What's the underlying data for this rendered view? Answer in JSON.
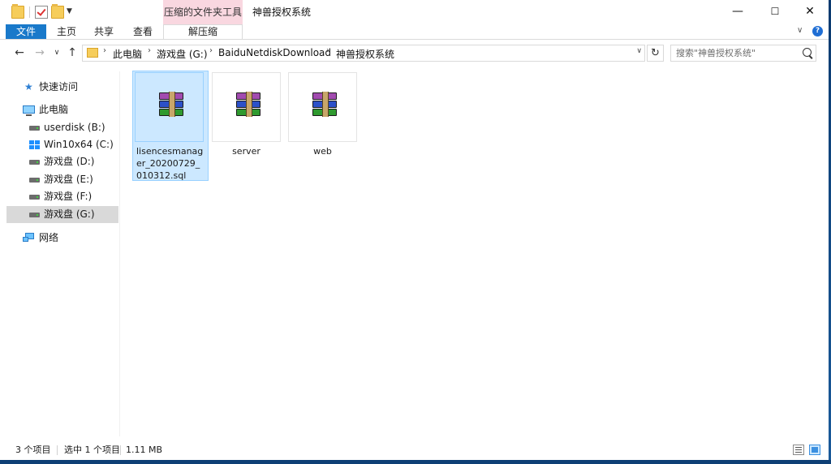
{
  "window": {
    "title": "神兽授权系统",
    "context_tab_title": "压缩的文件夹工具",
    "controls": {
      "minimize": "—",
      "maximize": "☐",
      "close": "✕"
    }
  },
  "ribbon": {
    "file_tab": "文件",
    "tabs": [
      "主页",
      "共享",
      "查看"
    ],
    "context_tab": "解压缩",
    "expand_glyph": "∨",
    "help_glyph": "?"
  },
  "navigation": {
    "back": "←",
    "forward": "→",
    "recent": "∨",
    "up": "↑",
    "refresh": "↻",
    "breadcrumbs": [
      "此电脑",
      "游戏盘 (G:)",
      "BaiduNetdiskDownload",
      "神兽授权系统"
    ],
    "separator": "›",
    "dropdown": "∨",
    "search_placeholder": "搜索\"神兽授权系统\""
  },
  "sidebar": {
    "quick_access": "快速访问",
    "this_pc": "此电脑",
    "drives": [
      {
        "label": "userdisk (B:)",
        "icon": "drive-icon"
      },
      {
        "label": "Win10x64 (C:)",
        "icon": "windows-drive-icon"
      },
      {
        "label": "游戏盘 (D:)",
        "icon": "drive-icon"
      },
      {
        "label": "游戏盘 (E:)",
        "icon": "drive-icon"
      },
      {
        "label": "游戏盘 (F:)",
        "icon": "drive-icon"
      },
      {
        "label": "游戏盘 (G:)",
        "icon": "drive-icon",
        "selected": true
      }
    ],
    "network": "网络"
  },
  "files": [
    {
      "name": "lisencesmanager_20200729_010312.sql",
      "icon": "winrar-archive-icon",
      "selected": true
    },
    {
      "name": "server",
      "icon": "winrar-archive-icon",
      "selected": false
    },
    {
      "name": "web",
      "icon": "winrar-archive-icon",
      "selected": false
    }
  ],
  "status": {
    "item_count": "3 个项目",
    "selected": "选中 1 个项目",
    "size": "1.11 MB"
  },
  "colors": {
    "accent": "#1979ca",
    "context_tab": "#f9d7e0",
    "selection": "#cce8ff"
  }
}
